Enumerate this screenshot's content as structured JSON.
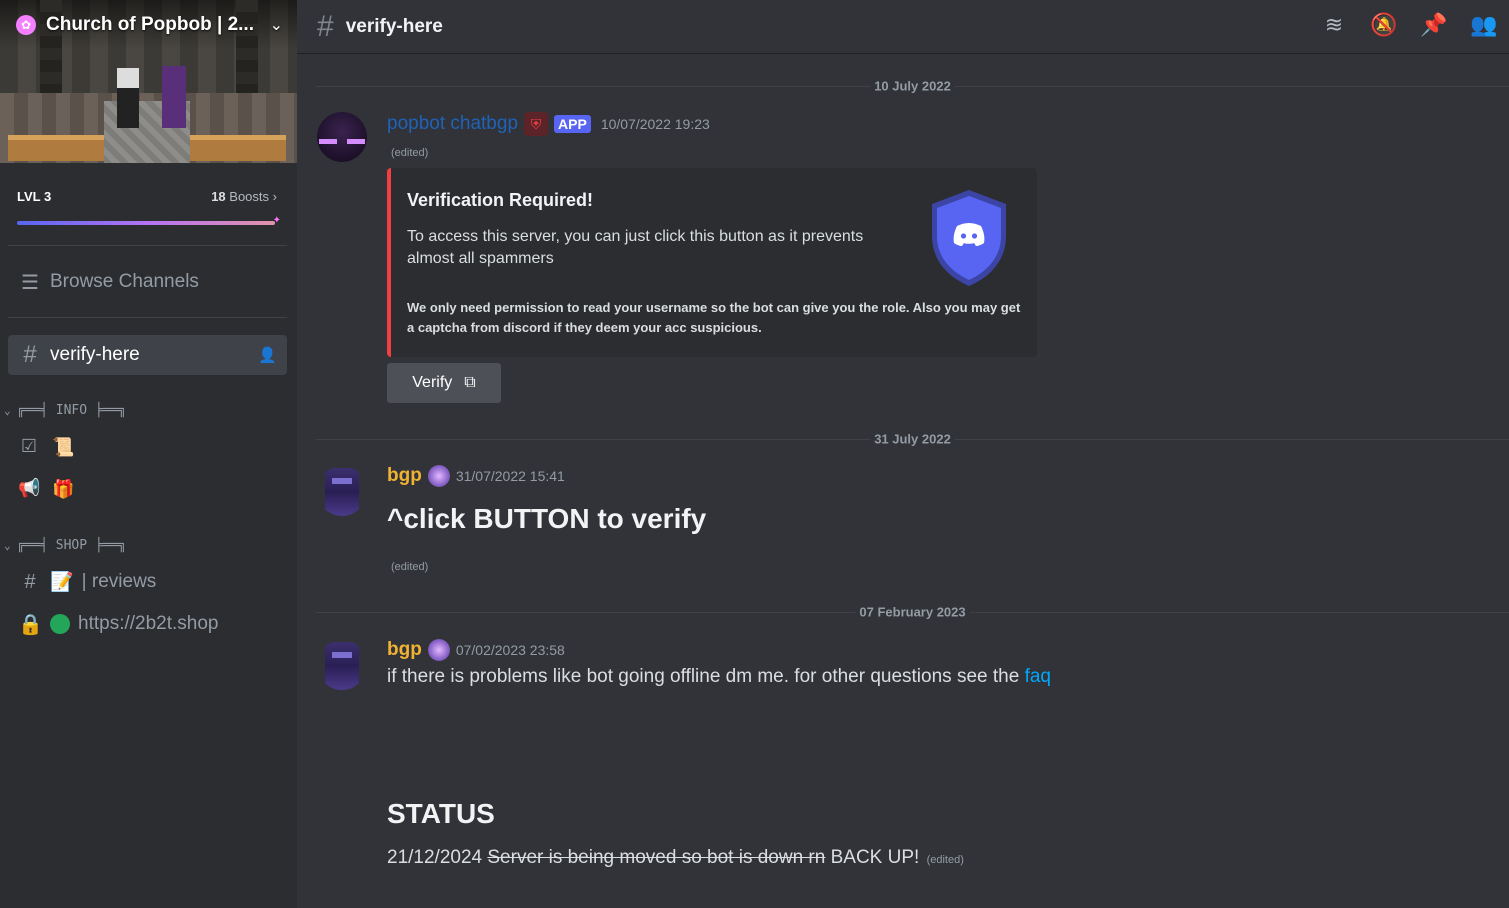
{
  "server": {
    "name": "Church of Popbob | 2...",
    "boost": {
      "level": "LVL 3",
      "count": "18",
      "count_label": "Boosts",
      "progress": 1.0
    }
  },
  "sidebar": {
    "browse_label": "Browse Channels",
    "active_channel": "verify-here",
    "categories": [
      {
        "name": "╔══╡ INFO ╞══╗"
      },
      {
        "name": "╔══╡ SHOP ╞══╗"
      }
    ],
    "info_channels": [
      {
        "icon": "rules-icon",
        "emoji": "📜"
      },
      {
        "icon": "announcement-icon",
        "emoji": "🎁"
      }
    ],
    "shop_channels": [
      {
        "icon": "hash-icon",
        "emoji": "📝",
        "label": "| reviews"
      },
      {
        "icon": "lock-icon",
        "label": "https://2b2t.shop"
      }
    ]
  },
  "topbar": {
    "channel": "verify-here",
    "icons": [
      "threads-icon",
      "mute-icon",
      "pin-icon",
      "members-icon"
    ]
  },
  "messages": {
    "sep1": "10 July 2022",
    "sep2": "31 July 2022",
    "sep3": "07 February 2023",
    "m1": {
      "author": "popbot chatbgp",
      "badge": "APP",
      "time": "10/07/2022 19:23",
      "edited": "(edited)",
      "embed": {
        "title": "Verification Required!",
        "description": "To access this server, you can just click this button as it prevents almost all spammers",
        "note": "We only need permission to read your username so the bot can give you the role. Also you may get a captcha from discord if they deem your acc suspicious."
      },
      "button": "Verify"
    },
    "m2": {
      "author": "bgp",
      "time": "31/07/2022 15:41",
      "text": "^click BUTTON to verify",
      "edited": "(edited)"
    },
    "m3": {
      "author": "bgp",
      "time": "07/02/2023 23:58",
      "text": "if there is problems like bot going offline dm me. for other questions see the",
      "link": "faq",
      "status_heading": "STATUS",
      "status_date": "21/12/2024",
      "status_struck": "Server is being moved so bot is down rn",
      "status_now": "BACK UP!",
      "status_edited": "(edited)"
    }
  },
  "colors": {
    "accent": "#5865f2",
    "embed_border": "#f23f43",
    "bgp_name": "#f0b232",
    "link": "#00a8fc"
  }
}
